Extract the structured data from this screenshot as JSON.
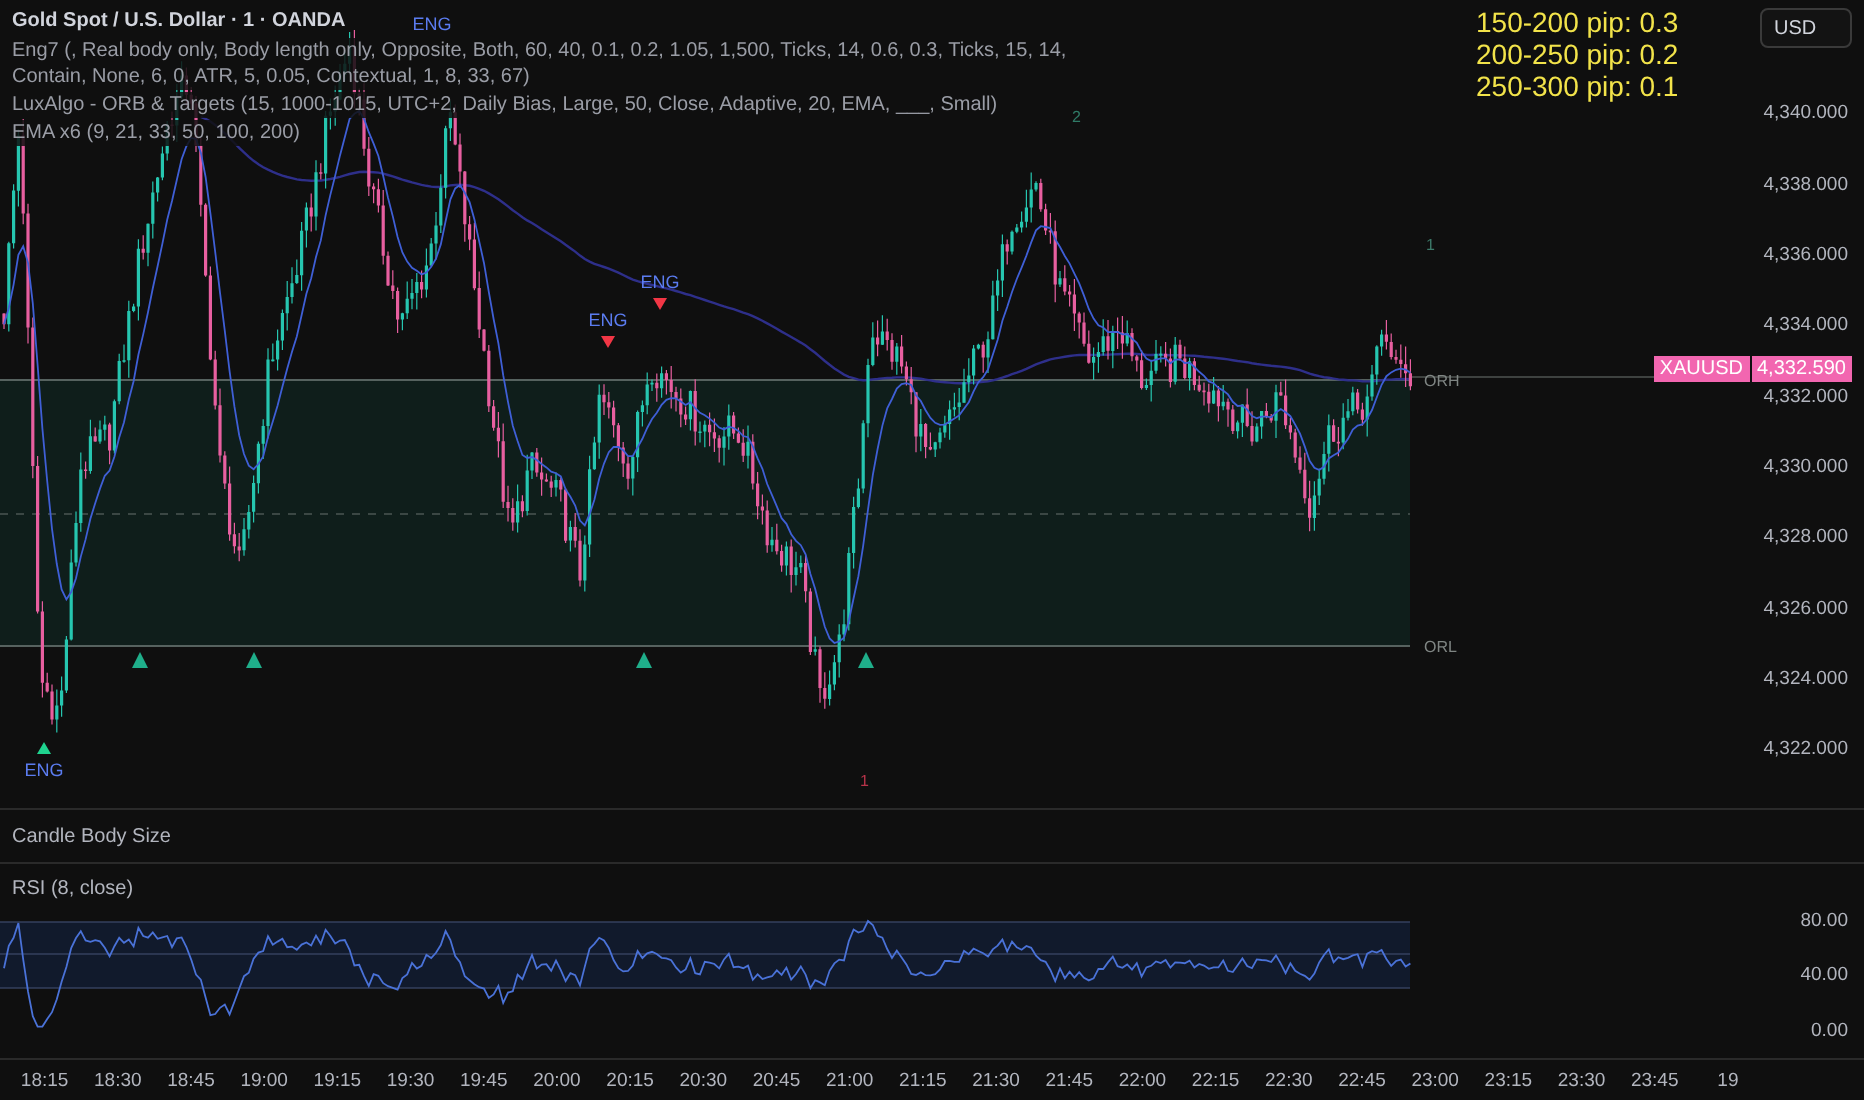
{
  "legend": {
    "title": "Gold Spot / U.S. Dollar · 1 · OANDA",
    "lines": [
      {
        "segments": [
          "Eng7 (, Real body only, Body length only, Opposite, Both, 60, 40, 0.1, 0.2, 1.05, 1,500, Ticks, 14, 0.6, 0.3, Ticks, 15, 14,",
          "Contain, None, 6, 0, ATR, 5, 0.05, Contextual, 1, 8, 33, 67)"
        ]
      },
      {
        "segments": [
          "LuxAlgo - ORB & Targets (15, 1000-1015, UTC+2, Daily Bias, Large, 50, Close, Adaptive, 20, EMA, ___, Small)"
        ]
      },
      {
        "segments": [
          "EMA x6  (9, 21, 33, 50, 100, 200)"
        ]
      }
    ]
  },
  "pip_stats": [
    "150-200 pip: 0.3",
    "200-250 pip: 0.2",
    "250-300 pip: 0.1"
  ],
  "chart": {
    "signals": [
      {
        "text": "ENG",
        "kind": "label"
      },
      {
        "text": "ENG",
        "kind": "bearish"
      },
      {
        "text": "ENG",
        "kind": "bearish"
      },
      {
        "text": "ENG",
        "kind": "bullish"
      }
    ],
    "range_labels": [
      "ORH",
      "ORL"
    ],
    "target_counts": [
      {
        "text": "2",
        "color": "#2f7a66"
      },
      {
        "text": "1",
        "color": "#3d7a6a"
      },
      {
        "text": "1",
        "color": "#b8334a"
      }
    ]
  },
  "price_axis": {
    "currency_button": "USD",
    "labels": [
      "4,340.000",
      "4,338.000",
      "4,336.000",
      "4,334.000",
      "4,332.000",
      "4,330.000",
      "4,328.000",
      "4,326.000",
      "4,324.000",
      "4,322.000"
    ]
  },
  "price_tag": {
    "symbol": "XAUUSD",
    "price": "4,332.590"
  },
  "panes": [
    {
      "kind": "empty",
      "title": "Candle Body Size"
    },
    {
      "kind": "rsi",
      "title": "RSI (8, close)",
      "ticks": [
        "80.00",
        "40.00",
        "0.00"
      ]
    }
  ],
  "time_axis": [
    "18:15",
    "18:30",
    "18:45",
    "19:00",
    "19:15",
    "19:30",
    "19:45",
    "20:00",
    "20:15",
    "20:30",
    "20:45",
    "21:00",
    "21:15",
    "21:30",
    "21:45",
    "22:00",
    "22:15",
    "22:30",
    "22:45",
    "23:00",
    "23:15",
    "23:30",
    "23:45",
    "19"
  ]
}
